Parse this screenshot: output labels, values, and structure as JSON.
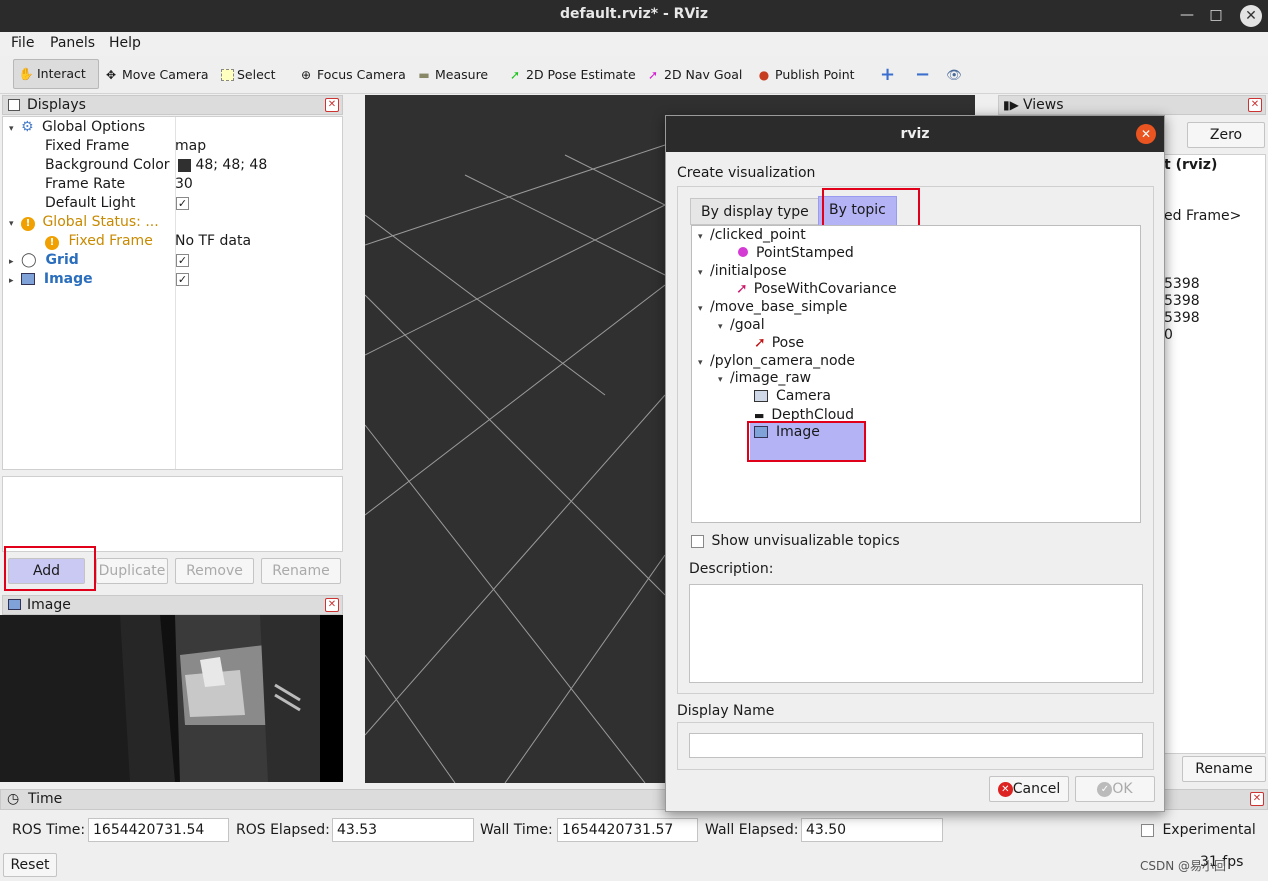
{
  "window": {
    "title": "default.rviz* - RViz"
  },
  "menu": {
    "file": "File",
    "panels": "Panels",
    "help": "Help"
  },
  "toolbar": {
    "interact": "Interact",
    "move_camera": "Move Camera",
    "select": "Select",
    "focus_camera": "Focus Camera",
    "measure": "Measure",
    "pose_estimate": "2D Pose Estimate",
    "nav_goal": "2D Nav Goal",
    "publish_point": "Publish Point"
  },
  "displays": {
    "title": "Displays",
    "global_options": "Global Options",
    "fixed_frame_label": "Fixed Frame",
    "fixed_frame_value": "map",
    "bg_color_label": "Background Color",
    "bg_color_value": "48; 48; 48",
    "frame_rate_label": "Frame Rate",
    "frame_rate_value": "30",
    "default_light_label": "Default Light",
    "global_status": "Global Status: ...",
    "status_fixed_frame": "Fixed Frame",
    "status_fixed_frame_value": "No TF data",
    "grid": "Grid",
    "image": "Image",
    "add": "Add",
    "duplicate": "Duplicate",
    "remove": "Remove",
    "rename": "Rename"
  },
  "image_panel": {
    "title": "Image"
  },
  "views": {
    "title": "Views",
    "zero": "Zero",
    "type": "t (rviz)",
    "frame": "ed Frame>",
    "v1": "5398",
    "v2": "5398",
    "v3": "5398",
    "v4": "0",
    "rename": "Rename"
  },
  "dialog": {
    "title": "rviz",
    "create_label": "Create visualization",
    "tab_display_type": "By display type",
    "tab_by_topic": "By topic",
    "tree": [
      {
        "label": "/clicked_point"
      },
      {
        "label": "PointStamped"
      },
      {
        "label": "/initialpose"
      },
      {
        "label": "PoseWithCovariance"
      },
      {
        "label": "/move_base_simple"
      },
      {
        "label": "/goal"
      },
      {
        "label": "Pose"
      },
      {
        "label": "/pylon_camera_node"
      },
      {
        "label": "/image_raw"
      },
      {
        "label": "Camera"
      },
      {
        "label": "DepthCloud"
      },
      {
        "label": "Image"
      }
    ],
    "show_unvisualizable": "Show unvisualizable topics",
    "description_label": "Description:",
    "display_name_label": "Display Name",
    "cancel": "Cancel",
    "ok": "OK"
  },
  "time": {
    "title": "Time",
    "ros_time_label": "ROS Time:",
    "ros_time": "1654420731.54",
    "ros_elapsed_label": "ROS Elapsed:",
    "ros_elapsed": "43.53",
    "wall_time_label": "Wall Time:",
    "wall_time": "1654420731.57",
    "wall_elapsed_label": "Wall Elapsed:",
    "wall_elapsed": "43.50",
    "experimental": "Experimental",
    "reset": "Reset",
    "fps": "31 fps",
    "watermark": "CSDN @易小回"
  },
  "colors": {
    "accent": "#e95420",
    "selection": "#b3b3f5",
    "highlight": "#e0001a",
    "viewport": "#303030"
  }
}
